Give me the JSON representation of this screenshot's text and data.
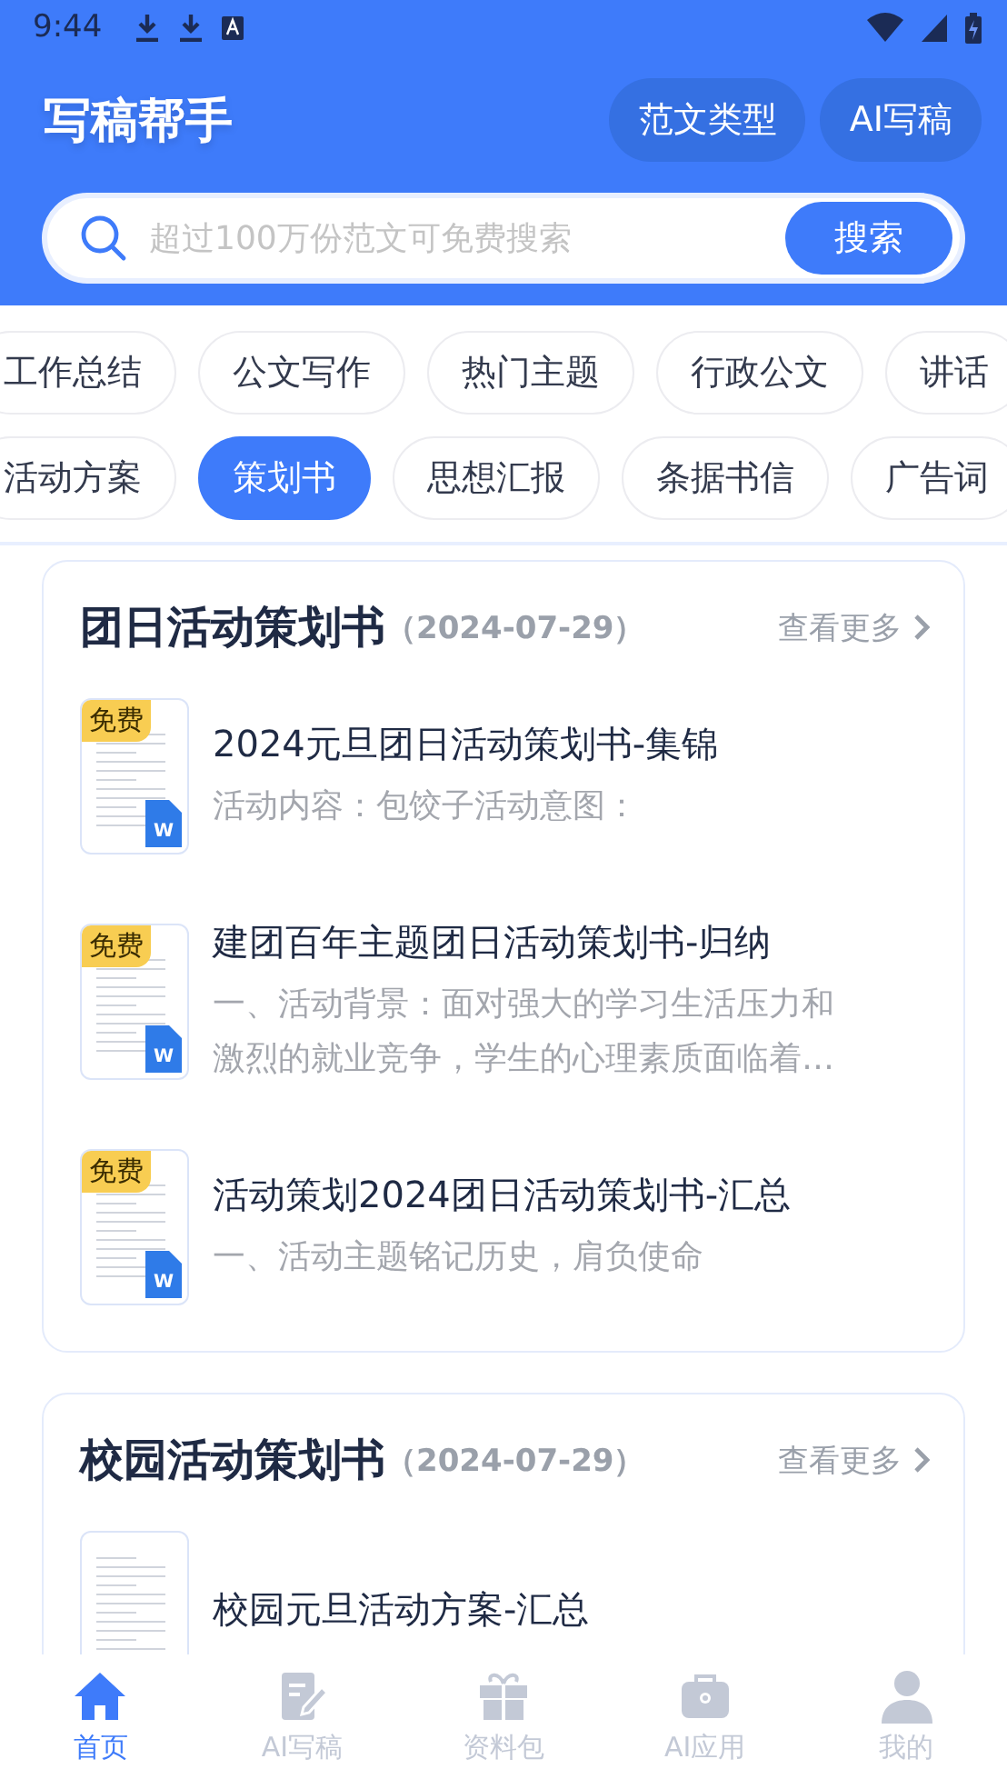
{
  "status_bar": {
    "time": "9:44"
  },
  "header": {
    "title": "写稿帮手",
    "actions": [
      {
        "label": "范文类型"
      },
      {
        "label": "AI写稿"
      }
    ]
  },
  "search": {
    "placeholder": "超过100万份范文可免费搜索",
    "button": "搜索"
  },
  "category_rows": [
    [
      {
        "label": "工作总结",
        "selected": false
      },
      {
        "label": "公文写作",
        "selected": false
      },
      {
        "label": "热门主题",
        "selected": false
      },
      {
        "label": "行政公文",
        "selected": false
      },
      {
        "label": "讲话",
        "selected": false
      }
    ],
    [
      {
        "label": "活动方案",
        "selected": false
      },
      {
        "label": "策划书",
        "selected": true
      },
      {
        "label": "思想汇报",
        "selected": false
      },
      {
        "label": "条据书信",
        "selected": false
      },
      {
        "label": "广告词",
        "selected": false
      }
    ]
  ],
  "sections": [
    {
      "title": "团日活动策划书",
      "date": "（2024-07-29）",
      "more": "查看更多",
      "items": [
        {
          "badge": "免费",
          "file_type": "W",
          "title": "2024元旦团日活动策划书-集锦",
          "summary": "活动内容：包饺子活动意图："
        },
        {
          "badge": "免费",
          "file_type": "W",
          "title": "建团百年主题团日活动策划书-归纳",
          "summary": "一、活动背景：面对强大的学习生活压力和激烈的就业竞争，学生的心理素质面临着…"
        },
        {
          "badge": "免费",
          "file_type": "W",
          "title": "活动策划2024团日活动策划书-汇总",
          "summary": "一、活动主题铭记历史，肩负使命"
        }
      ]
    },
    {
      "title": "校园活动策划书",
      "date": "（2024-07-29）",
      "more": "查看更多",
      "items": [
        {
          "title": "校园元旦活动方案-汇总"
        }
      ]
    }
  ],
  "tab_bar": [
    {
      "label": "首页",
      "kind": "home",
      "selected": true
    },
    {
      "label": "AI写稿",
      "kind": "write",
      "selected": false
    },
    {
      "label": "资料包",
      "kind": "gift",
      "selected": false
    },
    {
      "label": "AI应用",
      "kind": "toolbox",
      "selected": false
    },
    {
      "label": "我的",
      "kind": "user",
      "selected": false
    }
  ]
}
